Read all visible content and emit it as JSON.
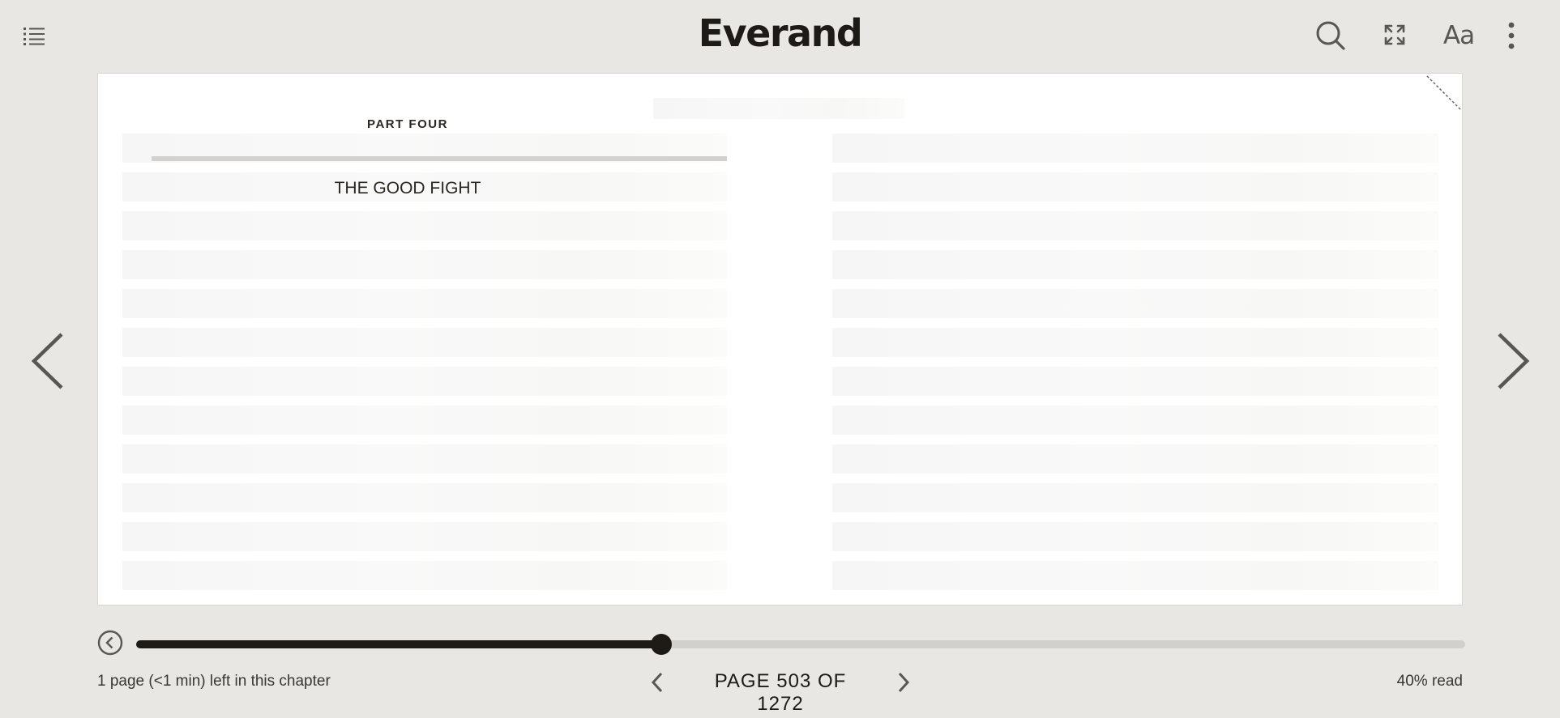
{
  "header": {
    "logo": "Everand",
    "icons": {
      "toc": "list-icon",
      "search": "search-icon",
      "fullscreen": "expand-icon",
      "font_settings": "Aa",
      "more": "more-vertical-icon"
    }
  },
  "book": {
    "part_label": "PART FOUR",
    "chapter_title": "THE GOOD FIGHT"
  },
  "progress": {
    "fraction": 0.395,
    "chapter_remaining": "1 page (<1 min) left in this chapter",
    "page_label": "PAGE 503 OF 1272",
    "percent_read": "40% read"
  },
  "colors": {
    "background": "#e9e7e4",
    "accent": "#1e1b16",
    "track": "#d1d0cd"
  }
}
